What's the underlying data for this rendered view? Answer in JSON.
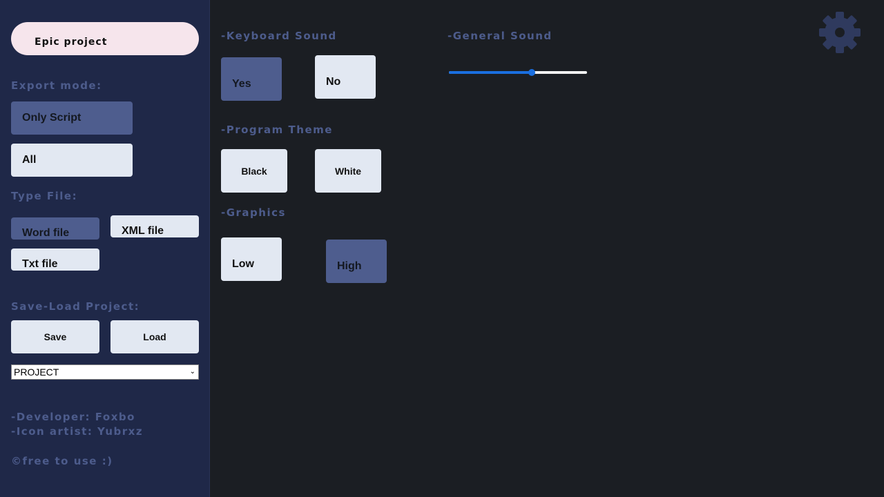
{
  "sidebar": {
    "project_name": "Epic project",
    "export_mode": {
      "label": "Export mode:",
      "options": [
        "Only Script",
        "All"
      ],
      "selected": "Only Script"
    },
    "type_file": {
      "label": "Type File:",
      "word": "Word file",
      "xml": "XML file",
      "txt": "Txt file",
      "selected": "Word file"
    },
    "save_load": {
      "label": "Save-Load Project:",
      "save": "Save",
      "load": "Load",
      "select_value": "PROJECT"
    },
    "credits": {
      "developer": "-Developer: Foxbo",
      "icon_artist": "-Icon artist: Yubrxz",
      "license": "©free to use :)"
    }
  },
  "settings": {
    "keyboard_sound": {
      "label": "-Keyboard Sound",
      "yes": "Yes",
      "no": "No",
      "selected": "Yes"
    },
    "general_sound": {
      "label": "-General Sound",
      "value_percent": 60
    },
    "program_theme": {
      "label": "-Program Theme",
      "black": "Black",
      "white": "White"
    },
    "graphics": {
      "label": "-Graphics",
      "low": "Low",
      "high": "High",
      "selected": "High"
    }
  },
  "colors": {
    "sidebar_bg": "#1f2848",
    "main_bg": "#1b1e23",
    "label": "#4d5c8c",
    "button": "#e2e8f2",
    "button_active": "#4e5d8e",
    "accent": "#1a6fe0",
    "project_pill": "#f6e5ec"
  },
  "icons": {
    "settings": "gear-icon"
  }
}
